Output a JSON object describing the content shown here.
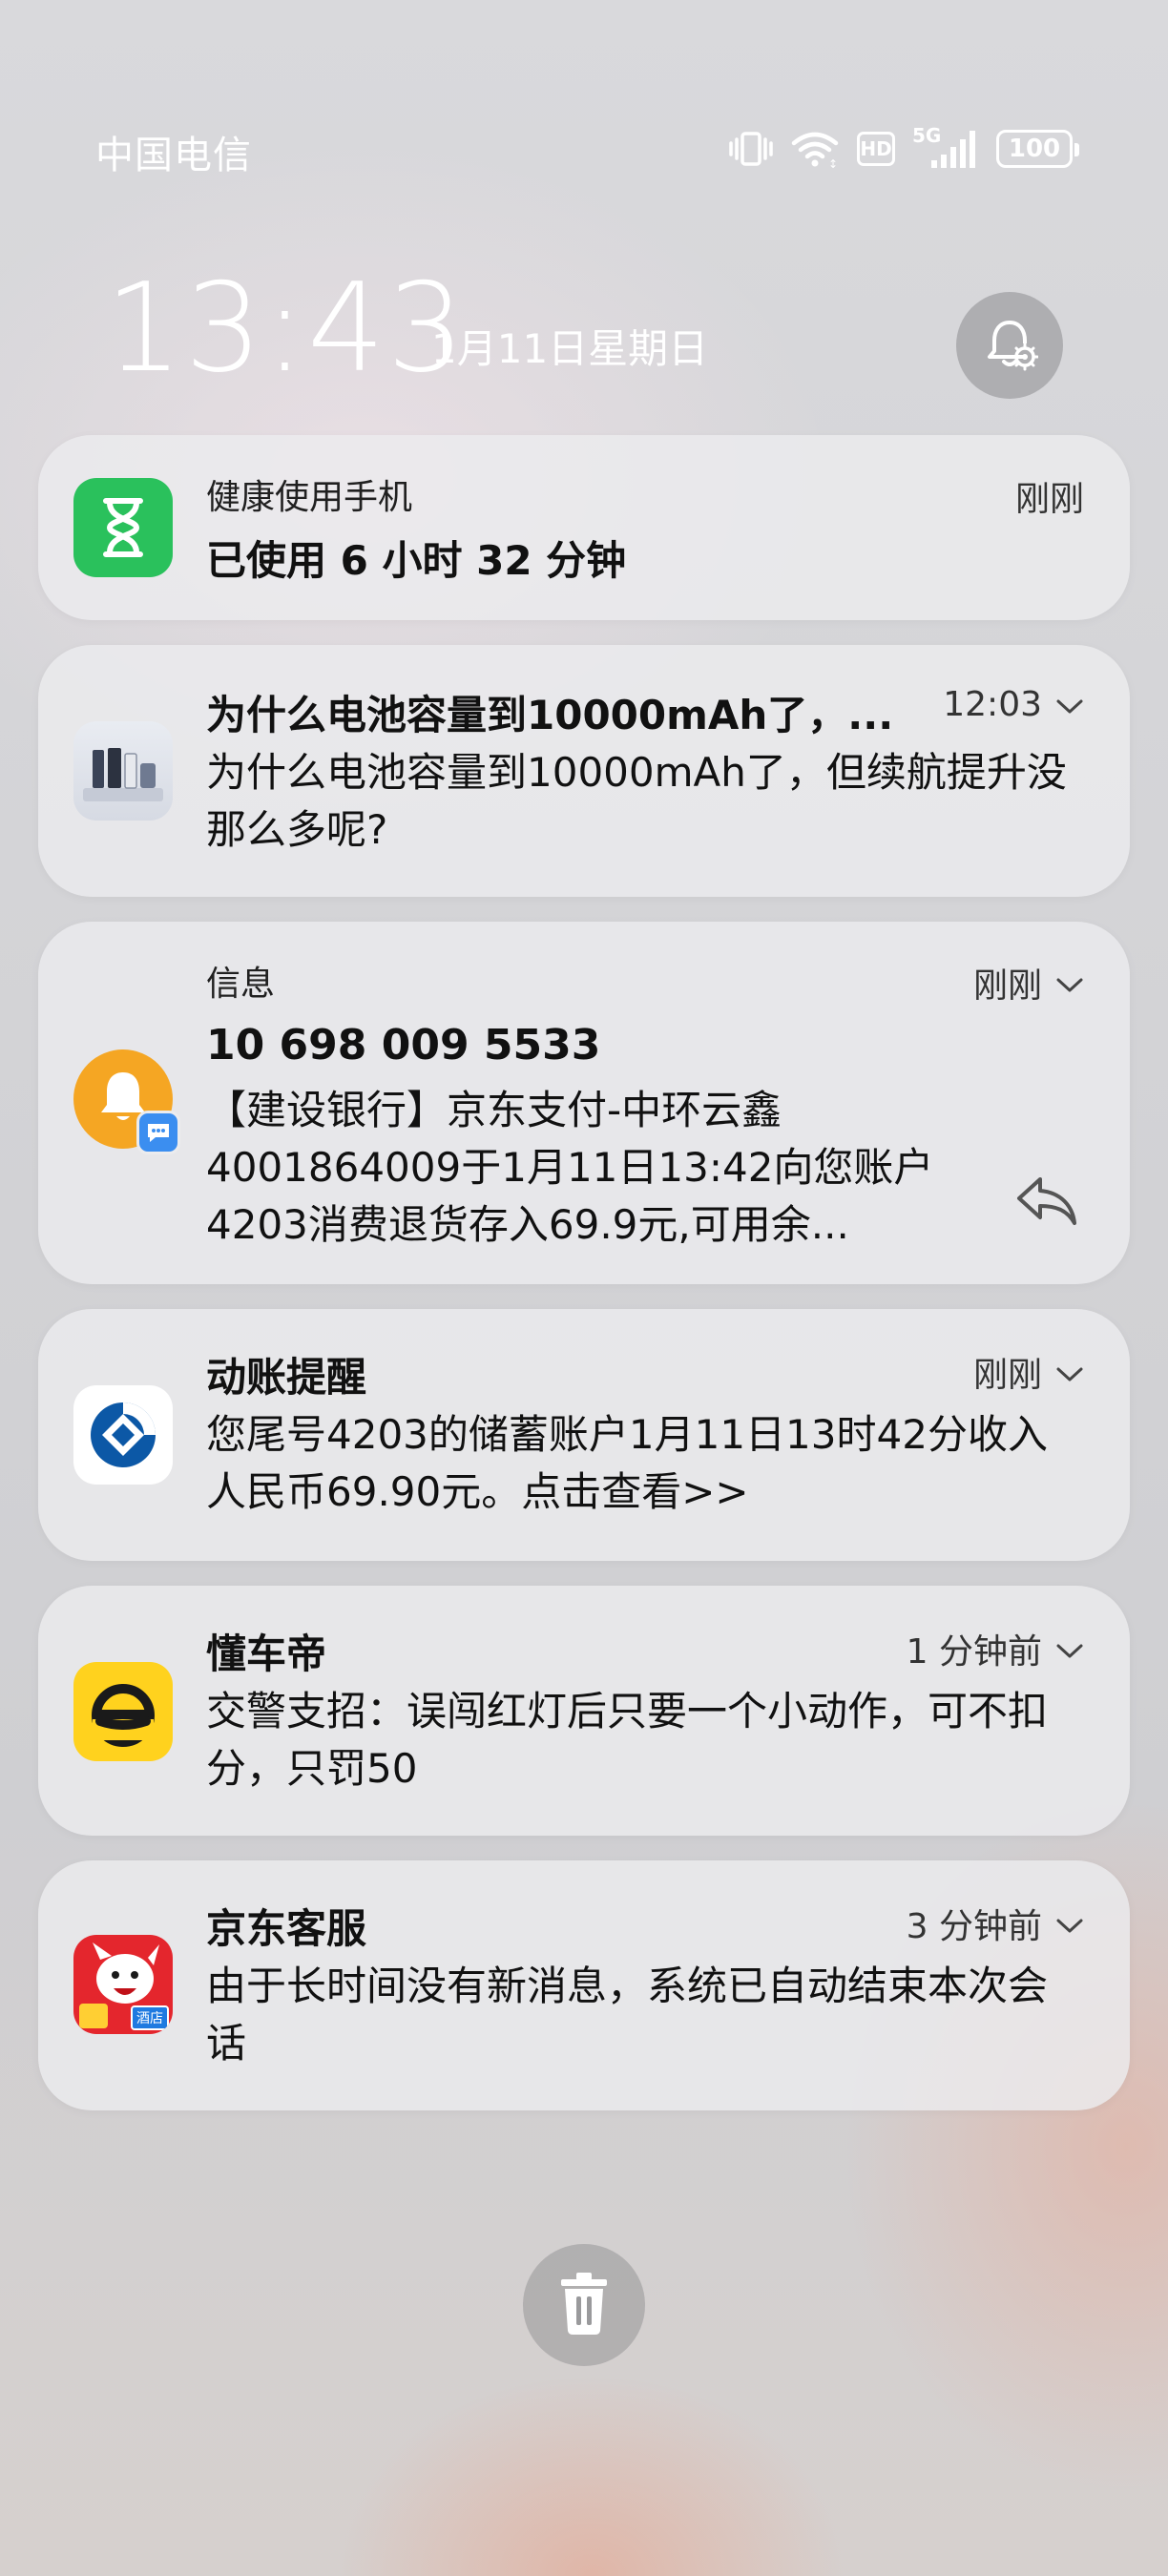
{
  "status_bar": {
    "carrier": "中国电信",
    "network_badge": "HD",
    "network_type": "5G",
    "battery": "100",
    "icons": [
      "vibrate-icon",
      "wifi-icon",
      "hd-icon",
      "signal-5g-icon",
      "battery-icon"
    ]
  },
  "lockscreen": {
    "time": "13:43",
    "date": "1月11日星期日"
  },
  "notifications": [
    {
      "app_name": "健康使用手机",
      "time": "刚刚",
      "body": "已使用 6 小时 32 分钟",
      "icon": "hourglass-icon",
      "icon_color": "#2ac15c"
    },
    {
      "title": "为什么电池容量到10000mAh了，...",
      "time": "12:03",
      "body": "为什么电池容量到10000mAh了，但续航提升没那么多呢?",
      "icon": "phone-thumbnail-icon"
    },
    {
      "app_name": "信息",
      "time": "刚刚",
      "title": "10 698 009 5533",
      "body": "【建设银行】京东支付-中环云鑫4001864009于1月11日13:42向您账户4203消费退货存入69.9元,可用余...",
      "icon": "bell-icon",
      "icon_color": "#f5a623",
      "badge_icon": "message-bubble-icon",
      "action_icon": "reply-icon"
    },
    {
      "title": "动账提醒",
      "time": "刚刚",
      "body": "您尾号4203的储蓄账户1月11日13时42分收入人民币69.90元。点击查看>>",
      "icon": "ccb-bank-icon",
      "icon_color": "#0c58a6"
    },
    {
      "title": "懂车帝",
      "time": "1 分钟前",
      "body": "交警支招：误闯红灯后只要一个小动作，可不扣分，只罚50",
      "icon": "dongchedi-icon",
      "icon_color": "#ffd21e"
    },
    {
      "title": "京东客服",
      "time": "3 分钟前",
      "body": "由于长时间没有新消息，系统已自动结束本次会话",
      "icon": "jd-mascot-icon",
      "icon_color": "#e4262d",
      "icon_label": "酒店"
    }
  ],
  "actions": {
    "clear_all_icon": "trash-icon"
  }
}
